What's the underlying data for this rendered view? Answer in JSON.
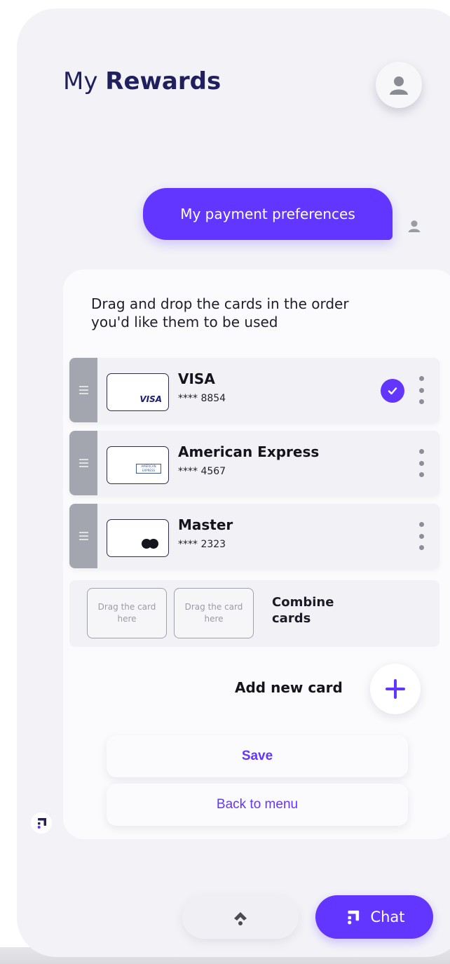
{
  "header": {
    "title_prefix": "My",
    "title_bold": "Rewards",
    "avatar_icon": "user-avatar-icon"
  },
  "chat": {
    "user_message": "My payment preferences",
    "user_avatar_icon": "user-avatar-icon"
  },
  "panel": {
    "instruction": "Drag and drop the cards in the order you'd like them to be used",
    "cards": [
      {
        "name": "VISA",
        "number": "**** 8854",
        "logo": "VISA",
        "selected": true
      },
      {
        "name": "American Express",
        "number": "**** 4567",
        "logo": "AMERICAN EXPRESS",
        "selected": false
      },
      {
        "name": "Master",
        "number": "**** 2323",
        "logo": "mastercard-logo",
        "selected": false
      }
    ],
    "combine": {
      "slot_1": "Drag the card here",
      "slot_2": "Drag the card here",
      "label": "Combine cards"
    },
    "add_card_label": "Add new card",
    "save_label": "Save",
    "back_label": "Back to menu"
  },
  "footer": {
    "chat_label": "Chat",
    "scroll_up_icon": "chevron-up-icon",
    "chat_icon": "bot-icon"
  },
  "colors": {
    "accent": "#6236ff",
    "title": "#21205e",
    "background": "#f3f3f7",
    "handle": "#a3a6ae"
  }
}
